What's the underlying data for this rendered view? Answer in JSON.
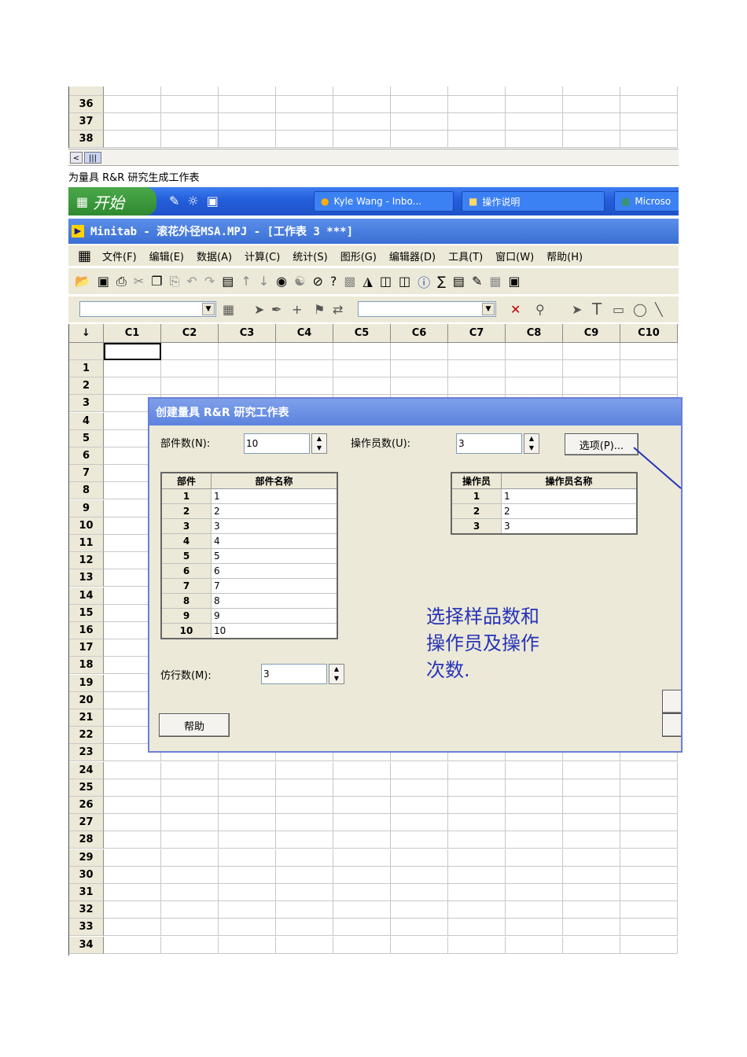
{
  "top_rows": [
    "36",
    "37",
    "38"
  ],
  "hscroll": {
    "left_arrow": "<",
    "thumb": "|||"
  },
  "caption": "为量具 R&R 研究生成工作表",
  "taskbar": {
    "start_label": "开始",
    "tasks": [
      {
        "label": "Kyle Wang - Inbo..."
      },
      {
        "label": "操作说明"
      },
      {
        "label": "Microso"
      }
    ]
  },
  "app_title": "Minitab - 滚花外径MSA.MPJ - [工作表 3 ***]",
  "menu": [
    "文件(F)",
    "编辑(E)",
    "数据(A)",
    "计算(C)",
    "统计(S)",
    "图形(G)",
    "编辑器(D)",
    "工具(T)",
    "窗口(W)",
    "帮助(H)"
  ],
  "columns": [
    "C1",
    "C2",
    "C3",
    "C4",
    "C5",
    "C6",
    "C7",
    "C8",
    "C9",
    "C10"
  ],
  "row_numbers": [
    "1",
    "2",
    "3",
    "4",
    "5",
    "6",
    "7",
    "8",
    "9",
    "10",
    "11",
    "12",
    "13",
    "14",
    "15",
    "16",
    "17",
    "18",
    "19",
    "20",
    "21",
    "22",
    "23",
    "24",
    "25",
    "26",
    "27",
    "28",
    "29",
    "30",
    "31",
    "32",
    "33",
    "34"
  ],
  "dialog": {
    "title": "创建量具 R&R 研究工作表",
    "parts_label": "部件数(N):",
    "parts_value": "10",
    "operators_label": "操作员数(U):",
    "operators_value": "3",
    "options_button": "选项(P)...",
    "parts_table": {
      "headers": [
        "部件",
        "部件名称"
      ],
      "rows": [
        [
          "1",
          "1"
        ],
        [
          "2",
          "2"
        ],
        [
          "3",
          "3"
        ],
        [
          "4",
          "4"
        ],
        [
          "5",
          "5"
        ],
        [
          "6",
          "6"
        ],
        [
          "7",
          "7"
        ],
        [
          "8",
          "8"
        ],
        [
          "9",
          "9"
        ],
        [
          "10",
          "10"
        ]
      ]
    },
    "operators_table": {
      "headers": [
        "操作员",
        "操作员名称"
      ],
      "rows": [
        [
          "1",
          "1"
        ],
        [
          "2",
          "2"
        ],
        [
          "3",
          "3"
        ]
      ]
    },
    "replicates_label": "仿行数(M):",
    "replicates_value": "3",
    "help_button": "帮助"
  },
  "annotation": "选择样品数和\n操作员及操作\n次数."
}
